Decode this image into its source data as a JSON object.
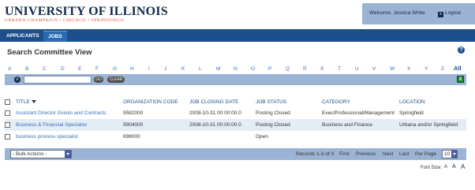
{
  "header": {
    "logo_title": "UNIVERSITY OF ILLINOIS",
    "logo_campuses": [
      "URBANA-CHAMPAIGN",
      "CHICAGO",
      "SPRINGFIELD"
    ],
    "welcome_text": "Welcome, Jessica White",
    "logout_label": "Logout"
  },
  "nav": {
    "tabs": [
      {
        "label": "APPLICANTS",
        "active": false
      },
      {
        "label": "JOBS",
        "active": true
      }
    ]
  },
  "page": {
    "title": "Search Committee View",
    "help_icon": "?"
  },
  "alpha_filter": [
    "A",
    "B",
    "C",
    "D",
    "E",
    "F",
    "G",
    "H",
    "I",
    "J",
    "K",
    "L",
    "M",
    "N",
    "O",
    "P",
    "Q",
    "R",
    "S",
    "T",
    "U",
    "V",
    "W",
    "X",
    "Y",
    "Z",
    "All"
  ],
  "search": {
    "value": "",
    "go_label": "GO",
    "clear_label": "CLEAR",
    "export_icon": "excel-icon"
  },
  "table": {
    "columns": [
      "TITLE",
      "ORGANIZATION CODE",
      "JOB CLOSING DATE",
      "JOB STATUS",
      "CATEGORY",
      "LOCATION"
    ],
    "rows": [
      {
        "title": "Assistant Director Grants and Contracts",
        "org_code": "9582000",
        "closing": "2008-10-31 00:00:00.0",
        "status": "Posting Closed",
        "category": "Exec/Professional/Management",
        "location": "Springfield"
      },
      {
        "title": "Business & Financial Specialist",
        "org_code": "9904000",
        "closing": "2008-10-31 00:00:00.0",
        "status": "Posting Closed",
        "category": "Business and Finance",
        "location": "Urbana and/or Springfield"
      },
      {
        "title": "business process specialist",
        "org_code": "698000",
        "closing": "",
        "status": "Open",
        "category": "",
        "location": ""
      }
    ]
  },
  "footer": {
    "bulk_actions": "- Bulk Actions -",
    "records": "Records 1-3 of 3",
    "first": "First",
    "previous": "Previous",
    "next": "Next",
    "last": "Last",
    "per_page_label": "Per Page",
    "per_page_value": "10"
  },
  "font_size": {
    "label": "Font Size:",
    "options": [
      "A",
      "A",
      "A"
    ]
  },
  "colors": {
    "brand_navy": "#13294b",
    "brand_orange": "#e84a27",
    "nav_blue": "#1c4f8c",
    "bar_blue": "#9cb4d4",
    "link_blue": "#3a6fb5"
  }
}
